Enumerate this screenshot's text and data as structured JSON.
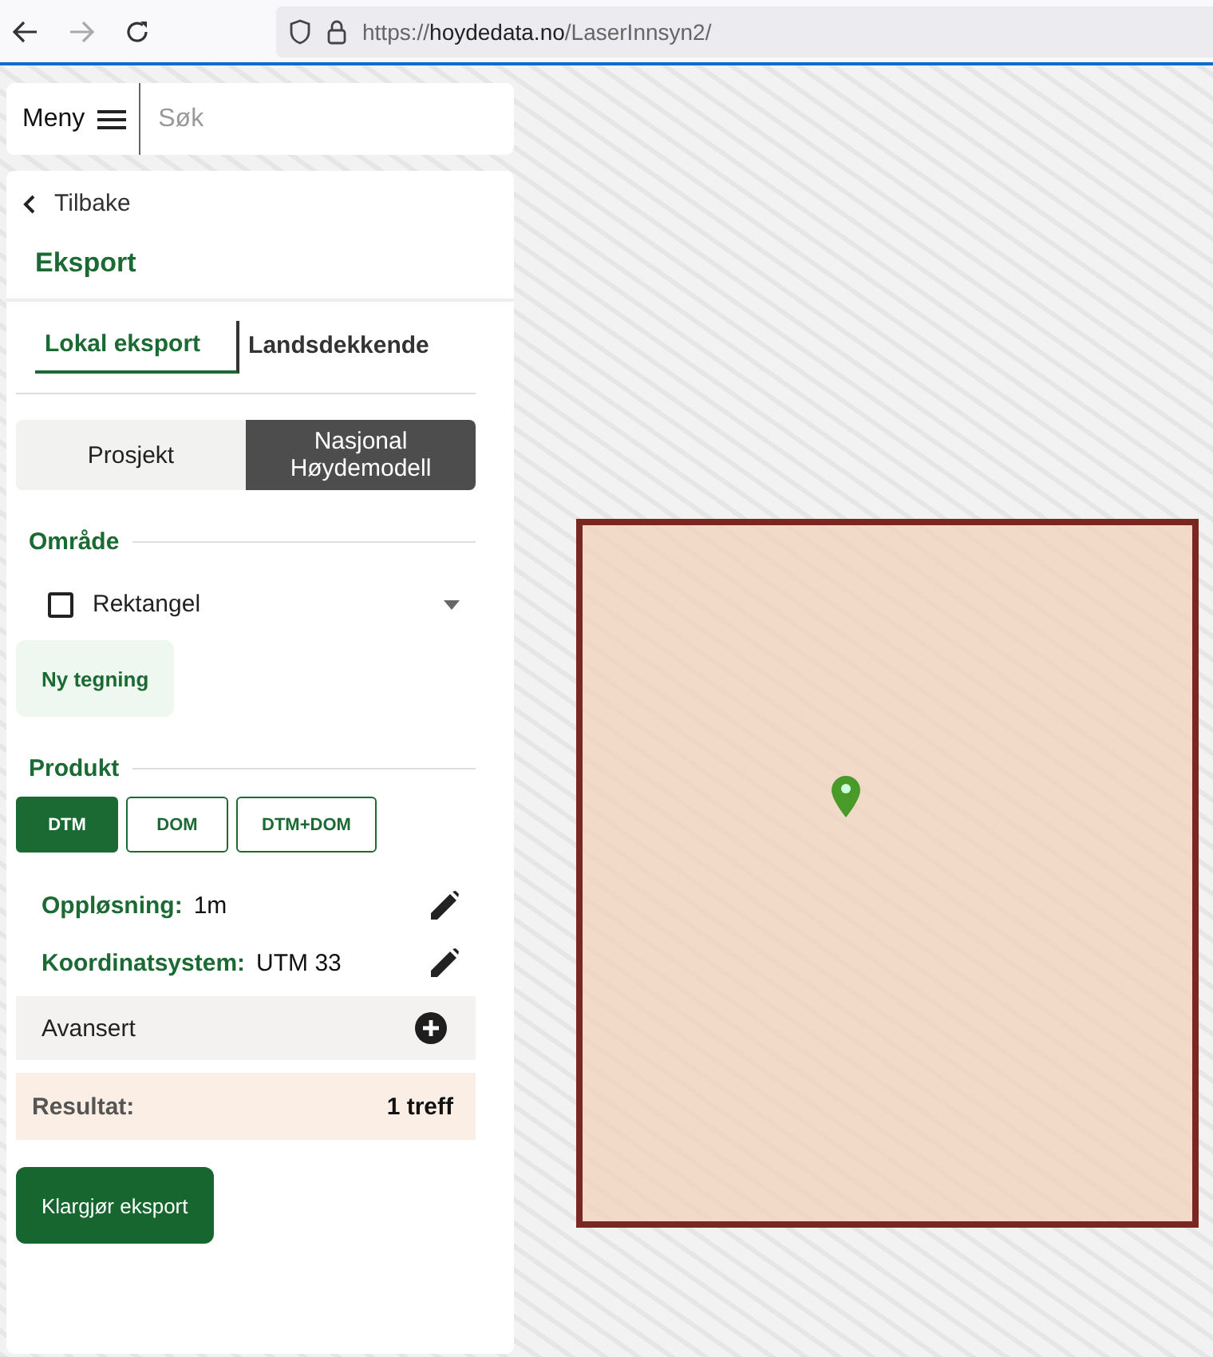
{
  "browser": {
    "back_enabled": true,
    "forward_enabled": false,
    "url": {
      "scheme": "https://",
      "host": "hoydedata.no",
      "path": "/LaserInnsyn2/"
    }
  },
  "search": {
    "menu_label": "Meny",
    "placeholder": "Søk"
  },
  "panel": {
    "back_label": "Tilbake",
    "title": "Eksport",
    "tabs": [
      {
        "label": "Lokal eksport",
        "selected": true
      },
      {
        "label": "Landsdekkende",
        "selected": false
      }
    ],
    "segments": [
      {
        "label": "Prosjekt",
        "selected": false
      },
      {
        "label": "Nasjonal Høydemodell",
        "selected": true
      }
    ],
    "area": {
      "title": "Område",
      "option": {
        "label": "Rektangel",
        "checked": false
      },
      "button": "Ny tegning"
    },
    "product": {
      "title": "Produkt",
      "options": [
        {
          "label": "DTM",
          "selected": true
        },
        {
          "label": "DOM",
          "selected": false
        },
        {
          "label": "DTM+DOM",
          "selected": false
        }
      ]
    },
    "settings": [
      {
        "label": "Oppløsning:",
        "value": "1m"
      },
      {
        "label": "Koordinatsystem:",
        "value": "UTM 33"
      }
    ],
    "advanced": {
      "label": "Avansert",
      "expanded": false
    },
    "result": {
      "label": "Resultat:",
      "value": "1 treff"
    },
    "submit": "Klargjør eksport"
  },
  "map": {
    "selection": true,
    "marker": true
  }
}
